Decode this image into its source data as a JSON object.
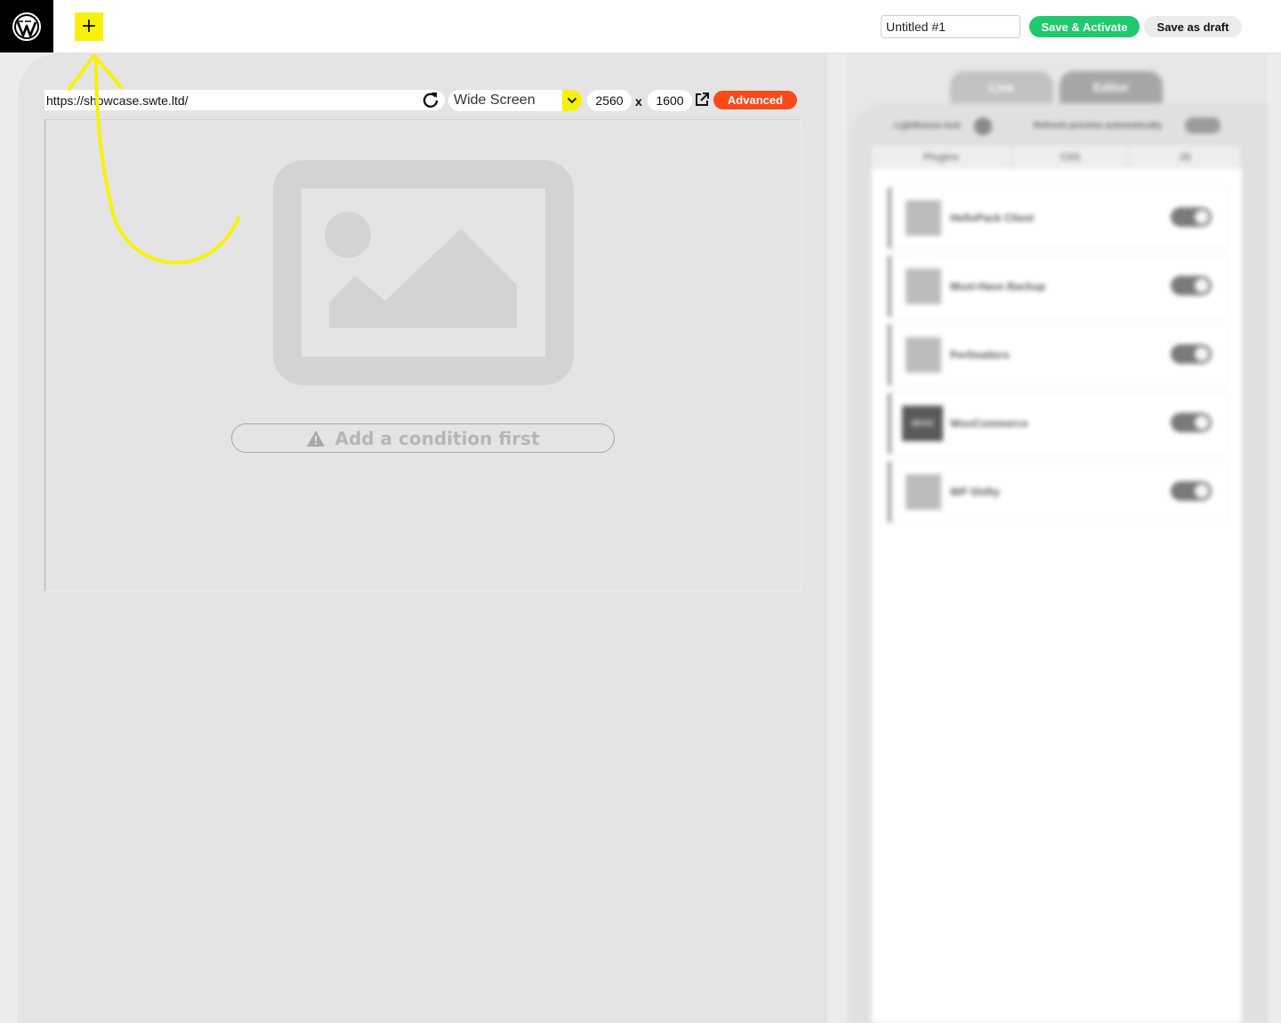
{
  "topbar": {
    "logo_icon": "wordpress-logo-icon",
    "add_label": "+",
    "title_value": "Untitled #1",
    "save_activate_label": "Save & Activate",
    "save_draft_label": "Save as draft"
  },
  "preview": {
    "url": "https://showcase.swte.ltd/",
    "device": "Wide Screen",
    "width": "2560",
    "times": "x",
    "height": "1600",
    "advanced_label": "Advanced",
    "condition_label": "Add a condition first"
  },
  "sidebar": {
    "tabs": [
      "Live",
      "Editor"
    ],
    "lighthouse_label": "Lighthouse test",
    "refresh_label": "Refresh preview automatically",
    "sub_tabs": [
      "Plugins",
      "CSS",
      "JS"
    ],
    "plugins": [
      {
        "name": "HelloPack Client"
      },
      {
        "name": "Must-Have Backup"
      },
      {
        "name": "Perfmatters"
      },
      {
        "name": "WooCommerce",
        "icon_text": "WOO"
      },
      {
        "name": "WP Shifty"
      }
    ]
  },
  "colors": {
    "accent_yellow": "#f7f10a",
    "save_green": "#1fc96e",
    "advanced_orange": "#fa4a1a"
  }
}
